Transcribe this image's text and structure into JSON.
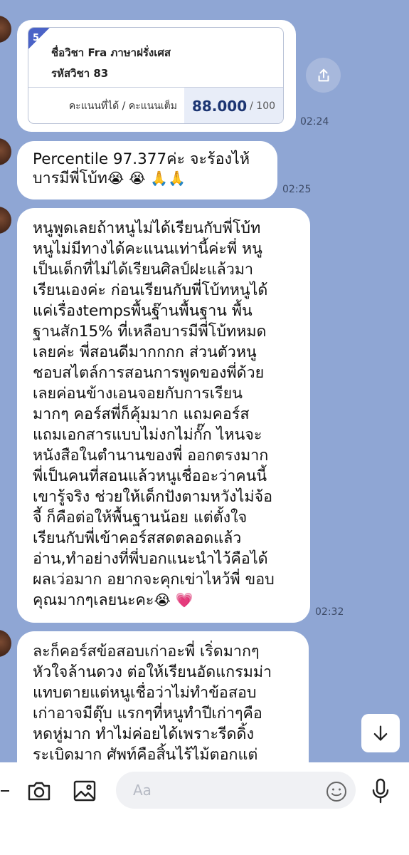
{
  "score_card": {
    "badge": "5",
    "subject_name": "ชื่อวิชา Fra ภาษาฝรั่งเศส",
    "subject_code": "รหัสวิชา 83",
    "score_label": "คะแนนที่ได้ / คะแนนเต็ม",
    "score": "88.000",
    "max_score": "/ 100",
    "time": "02:24"
  },
  "messages": [
    {
      "lines": [
        "Percentile 97.377ค่ะ จะร้องไห้",
        "บารมีพี่โบ้ท"
      ],
      "emojis": [
        "crying-face",
        "crying-face",
        "folded-hands",
        "folded-hands"
      ],
      "time": "02:25"
    },
    {
      "lines": [
        "หนูพูดเลยถ้าหนูไม่ได้เรียนกับพี่โบ้ท",
        "หนูไม่มีทางได้คะแนนเท่านี้ค่ะพี่ หนู",
        "เป็นเด็กที่ไม่ได้เรียนศิลป์ฝะแล้วมา",
        "เรียนเองค่ะ ก่อนเรียนกับพี่โบ้ทหนูได้",
        "แค่เรื่องtempsพื้นฐ๊านพื้นฐาน พื้น",
        "ฐานสัก15% ที่เหลือบารมีพี่โบ้ทหมด",
        "เลยค่ะ พี่สอนดีมากกกก ส่วนตัวหนู",
        "ชอบสไตล์การสอนการพูดของพี่ด้วย",
        "เลยค่อนข้างเอนจอยกับการเรียน",
        "มากๆ คอร์สพี่ก็คุ้มมาก แถมคอร์ส",
        "แถมเอกสารแบบไม่งกไม่กั๊ก ไหนจะ",
        "หนังสือในตำนานของพี่ ออกตรงมาก",
        "พี่เป็นคนที่สอนแล้วหนูเชื่ออะว่าคนนี้",
        "เขารู้จริง ช่วยให้เด็กปังตามหวังไม่จ้อ",
        "จี้ ก็คือต่อให้พื้นฐานน้อย แต่ตั้งใจ",
        "เรียนกับพี่เข้าคอร์สสดตลอดแล้ว",
        "อ่าน,ทำอย่างที่พี่บอกแนะนำไว้คือได้",
        "ผลเว่อมาก อยากจะคุกเข่าไหว้พี่ ขอบ",
        "คุณมากๆเลยนะคะ"
      ],
      "emojis": [
        "crying-face",
        "pink-heart"
      ],
      "time": "02:32"
    },
    {
      "lines": [
        "ละก็คอร์สข้อสอบเก่าอะพี่ เริ่ดมากๆ",
        "หัวใจล้านดวง ต่อให้เรียนอัดแกรมม่า",
        "แทบตายแต่หนูเชื่อว่าไม่ทำข้อสอบ",
        "เก่าอาจมีตุ๊บ แรกๆที่หนูทำปีเก่าๆคือ",
        "หดหู่มาก ทำไม่ค่อยได้เพราะรีดดิ้ง",
        "ระเบิดมาก ศัพท์คือสิ้นไร้ไม้ตอกแต่"
      ]
    }
  ],
  "composer": {
    "placeholder": "Aa"
  }
}
